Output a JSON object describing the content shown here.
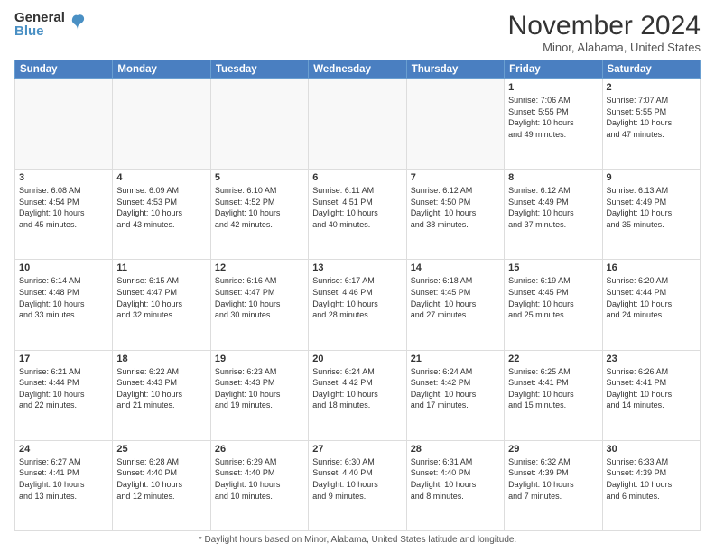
{
  "logo": {
    "general": "General",
    "blue": "Blue"
  },
  "title": "November 2024",
  "location": "Minor, Alabama, United States",
  "days_of_week": [
    "Sunday",
    "Monday",
    "Tuesday",
    "Wednesday",
    "Thursday",
    "Friday",
    "Saturday"
  ],
  "footer": "Daylight hours",
  "weeks": [
    [
      {
        "day": "",
        "info": ""
      },
      {
        "day": "",
        "info": ""
      },
      {
        "day": "",
        "info": ""
      },
      {
        "day": "",
        "info": ""
      },
      {
        "day": "",
        "info": ""
      },
      {
        "day": "1",
        "info": "Sunrise: 7:06 AM\nSunset: 5:55 PM\nDaylight: 10 hours\nand 49 minutes."
      },
      {
        "day": "2",
        "info": "Sunrise: 7:07 AM\nSunset: 5:55 PM\nDaylight: 10 hours\nand 47 minutes."
      }
    ],
    [
      {
        "day": "3",
        "info": "Sunrise: 6:08 AM\nSunset: 4:54 PM\nDaylight: 10 hours\nand 45 minutes."
      },
      {
        "day": "4",
        "info": "Sunrise: 6:09 AM\nSunset: 4:53 PM\nDaylight: 10 hours\nand 43 minutes."
      },
      {
        "day": "5",
        "info": "Sunrise: 6:10 AM\nSunset: 4:52 PM\nDaylight: 10 hours\nand 42 minutes."
      },
      {
        "day": "6",
        "info": "Sunrise: 6:11 AM\nSunset: 4:51 PM\nDaylight: 10 hours\nand 40 minutes."
      },
      {
        "day": "7",
        "info": "Sunrise: 6:12 AM\nSunset: 4:50 PM\nDaylight: 10 hours\nand 38 minutes."
      },
      {
        "day": "8",
        "info": "Sunrise: 6:12 AM\nSunset: 4:49 PM\nDaylight: 10 hours\nand 37 minutes."
      },
      {
        "day": "9",
        "info": "Sunrise: 6:13 AM\nSunset: 4:49 PM\nDaylight: 10 hours\nand 35 minutes."
      }
    ],
    [
      {
        "day": "10",
        "info": "Sunrise: 6:14 AM\nSunset: 4:48 PM\nDaylight: 10 hours\nand 33 minutes."
      },
      {
        "day": "11",
        "info": "Sunrise: 6:15 AM\nSunset: 4:47 PM\nDaylight: 10 hours\nand 32 minutes."
      },
      {
        "day": "12",
        "info": "Sunrise: 6:16 AM\nSunset: 4:47 PM\nDaylight: 10 hours\nand 30 minutes."
      },
      {
        "day": "13",
        "info": "Sunrise: 6:17 AM\nSunset: 4:46 PM\nDaylight: 10 hours\nand 28 minutes."
      },
      {
        "day": "14",
        "info": "Sunrise: 6:18 AM\nSunset: 4:45 PM\nDaylight: 10 hours\nand 27 minutes."
      },
      {
        "day": "15",
        "info": "Sunrise: 6:19 AM\nSunset: 4:45 PM\nDaylight: 10 hours\nand 25 minutes."
      },
      {
        "day": "16",
        "info": "Sunrise: 6:20 AM\nSunset: 4:44 PM\nDaylight: 10 hours\nand 24 minutes."
      }
    ],
    [
      {
        "day": "17",
        "info": "Sunrise: 6:21 AM\nSunset: 4:44 PM\nDaylight: 10 hours\nand 22 minutes."
      },
      {
        "day": "18",
        "info": "Sunrise: 6:22 AM\nSunset: 4:43 PM\nDaylight: 10 hours\nand 21 minutes."
      },
      {
        "day": "19",
        "info": "Sunrise: 6:23 AM\nSunset: 4:43 PM\nDaylight: 10 hours\nand 19 minutes."
      },
      {
        "day": "20",
        "info": "Sunrise: 6:24 AM\nSunset: 4:42 PM\nDaylight: 10 hours\nand 18 minutes."
      },
      {
        "day": "21",
        "info": "Sunrise: 6:24 AM\nSunset: 4:42 PM\nDaylight: 10 hours\nand 17 minutes."
      },
      {
        "day": "22",
        "info": "Sunrise: 6:25 AM\nSunset: 4:41 PM\nDaylight: 10 hours\nand 15 minutes."
      },
      {
        "day": "23",
        "info": "Sunrise: 6:26 AM\nSunset: 4:41 PM\nDaylight: 10 hours\nand 14 minutes."
      }
    ],
    [
      {
        "day": "24",
        "info": "Sunrise: 6:27 AM\nSunset: 4:41 PM\nDaylight: 10 hours\nand 13 minutes."
      },
      {
        "day": "25",
        "info": "Sunrise: 6:28 AM\nSunset: 4:40 PM\nDaylight: 10 hours\nand 12 minutes."
      },
      {
        "day": "26",
        "info": "Sunrise: 6:29 AM\nSunset: 4:40 PM\nDaylight: 10 hours\nand 10 minutes."
      },
      {
        "day": "27",
        "info": "Sunrise: 6:30 AM\nSunset: 4:40 PM\nDaylight: 10 hours\nand 9 minutes."
      },
      {
        "day": "28",
        "info": "Sunrise: 6:31 AM\nSunset: 4:40 PM\nDaylight: 10 hours\nand 8 minutes."
      },
      {
        "day": "29",
        "info": "Sunrise: 6:32 AM\nSunset: 4:39 PM\nDaylight: 10 hours\nand 7 minutes."
      },
      {
        "day": "30",
        "info": "Sunrise: 6:33 AM\nSunset: 4:39 PM\nDaylight: 10 hours\nand 6 minutes."
      }
    ]
  ]
}
